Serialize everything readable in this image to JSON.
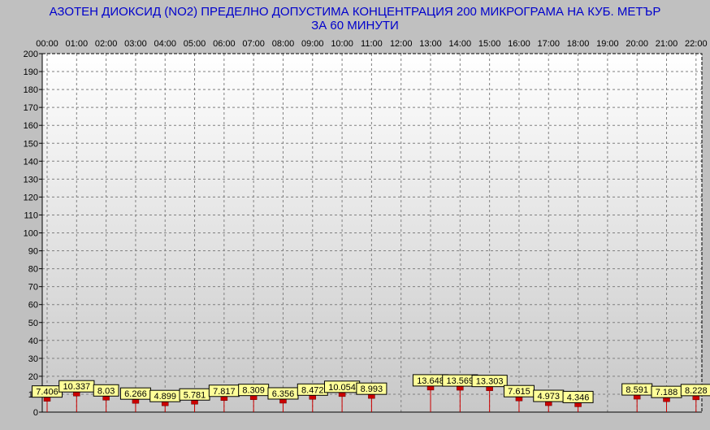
{
  "chart_data": {
    "type": "bar",
    "title": "АЗОТЕН ДИОКСИД   (NO2)     ПРЕДЕЛНО ДОПУСТИМА КОНЦЕНТРАЦИЯ 200 МИКРОГРАМА  НА КУБ. МЕТЪР",
    "subtitle": "ЗА 60 МИНУТИ",
    "xlabel": "",
    "ylabel": "",
    "ylim": [
      0,
      200
    ],
    "y_ticks": [
      0,
      10,
      20,
      30,
      40,
      50,
      60,
      70,
      80,
      90,
      100,
      110,
      120,
      130,
      140,
      150,
      160,
      170,
      180,
      190,
      200
    ],
    "grid": true,
    "legend": "none",
    "categories": [
      "00:00",
      "01:00",
      "02:00",
      "03:00",
      "04:00",
      "05:00",
      "06:00",
      "07:00",
      "08:00",
      "09:00",
      "10:00",
      "11:00",
      "12:00",
      "13:00",
      "14:00",
      "15:00",
      "16:00",
      "17:00",
      "18:00",
      "19:00",
      "20:00",
      "21:00",
      "22:00"
    ],
    "values": [
      7.406,
      10.337,
      8.03,
      6.266,
      4.899,
      5.781,
      7.817,
      8.309,
      6.356,
      8.472,
      10.054,
      8.993,
      null,
      13.648,
      13.569,
      13.303,
      7.615,
      4.973,
      4.346,
      null,
      8.591,
      7.188,
      8.228
    ],
    "data_labels": [
      "7.406",
      "10.337",
      "8.03",
      "6.266",
      "4.899",
      "5.781",
      "7.817",
      "8.309",
      "6.356",
      "8.472",
      "10.054",
      "8.993",
      "",
      "13.648",
      "13.569",
      "13.303",
      "7.615",
      "4.973",
      "4.346",
      "",
      "8.591",
      "7.188",
      "8.228"
    ],
    "colors": {
      "background": "#c0c0c0",
      "plot_top": "#ffffff",
      "plot_bottom": "#c8c8c8",
      "title": "#0000cc",
      "marker": "#cc0000",
      "label_fill": "#ffff99",
      "grid": "#808080"
    }
  }
}
